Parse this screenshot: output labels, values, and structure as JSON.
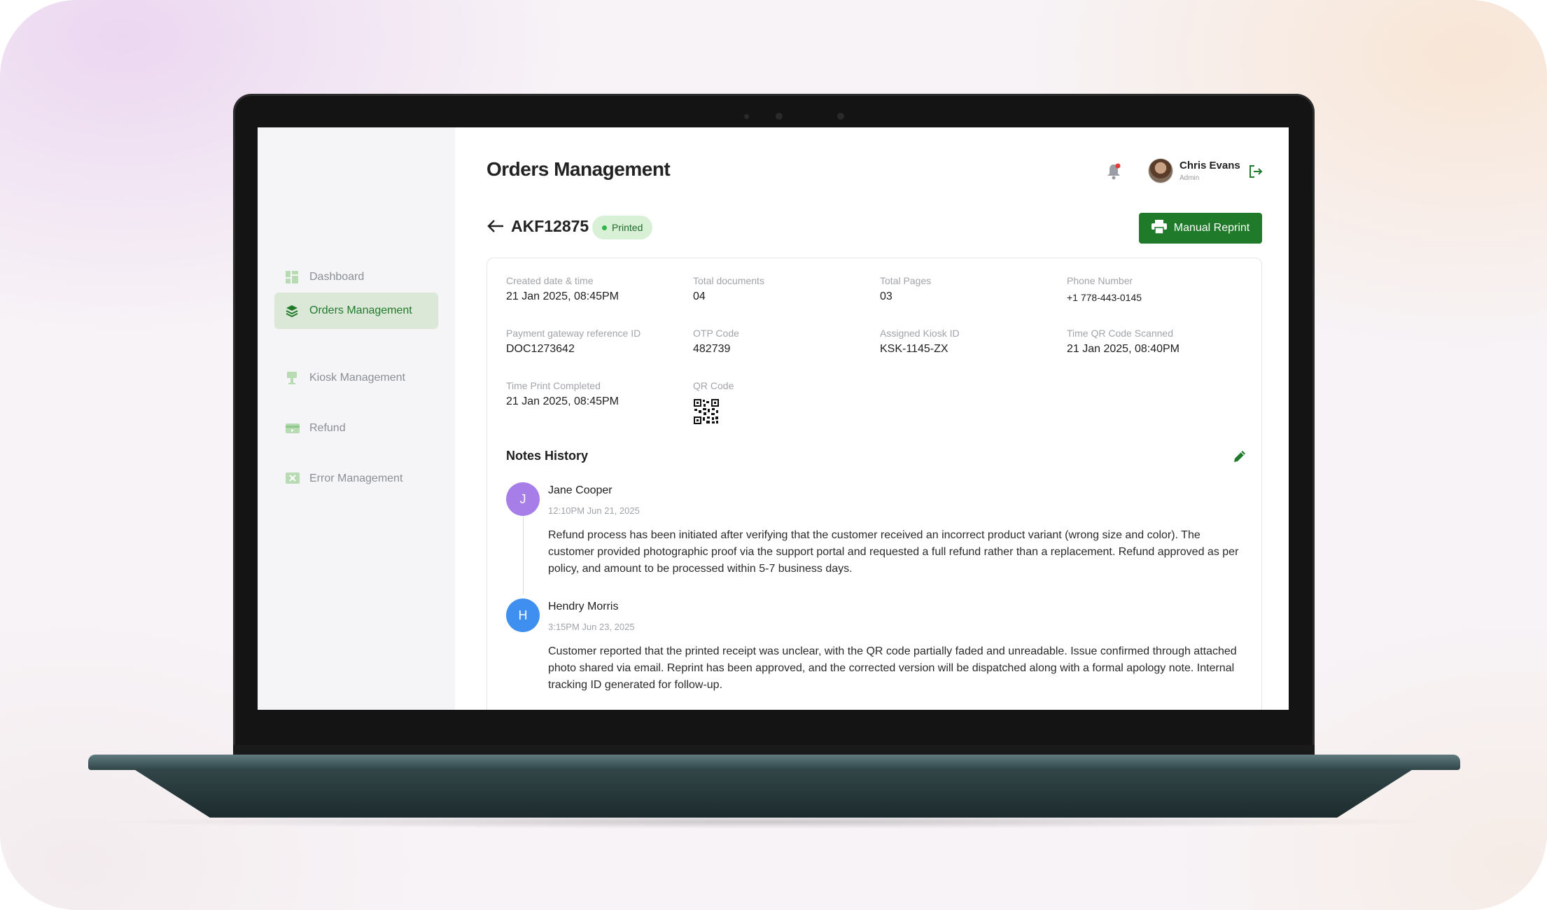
{
  "sidebar": {
    "items": [
      {
        "label": "Dashboard"
      },
      {
        "label": "Orders Management",
        "active": true
      },
      {
        "label": "Kiosk Management"
      },
      {
        "label": "Refund"
      },
      {
        "label": "Error Management"
      }
    ]
  },
  "header": {
    "title": "Orders Management",
    "user": {
      "name": "Chris Evans",
      "role": "Admin"
    }
  },
  "order": {
    "id": "AKF12875",
    "status": "Printed",
    "reprint_label": "Manual Reprint"
  },
  "details": {
    "created_label": "Created date & time",
    "created_value": "21 Jan 2025, 08:45PM",
    "docs_label": "Total documents",
    "docs_value": "04",
    "pages_label": "Total Pages",
    "pages_value": "03",
    "phone_label": "Phone Number",
    "phone_value": "+1 778-443-0145",
    "pg_label": "Payment gateway reference ID",
    "pg_value": "DOC1273642",
    "otp_label": "OTP Code",
    "otp_value": "482739",
    "kiosk_label": "Assigned Kiosk ID",
    "kiosk_value": "KSK-1145-ZX",
    "scan_label": "Time QR Code Scanned",
    "scan_value": "21 Jan 2025, 08:40PM",
    "print_label": "Time Print Completed",
    "print_value": "21 Jan 2025, 08:45PM",
    "qr_label": "QR Code"
  },
  "notes": {
    "title": "Notes History",
    "items": [
      {
        "initial": "J",
        "name": "Jane Cooper",
        "time": "12:10PM Jun 21, 2025",
        "text": "Refund process has been initiated after verifying that the customer received an incorrect product variant (wrong size and color). The customer provided photographic proof via the support portal and requested a full refund rather than a replacement. Refund approved as per policy, and amount to be processed within 5-7 business days.",
        "color": "#a77ee8"
      },
      {
        "initial": "H",
        "name": "Hendry Morris",
        "time": "3:15PM Jun 23, 2025",
        "text": "Customer reported that the printed receipt was unclear, with the QR code partially faded and unreadable. Issue confirmed through attached photo shared via email. Reprint has been approved, and the corrected version will be dispatched along with a formal apology note. Internal tracking ID generated for follow-up.",
        "color": "#3f8ff0"
      }
    ]
  },
  "colors": {
    "accent": "#1f7a2a",
    "badge_bg": "#d8f0d6",
    "nav_active_bg": "#dbe8d8"
  },
  "icons": [
    "dashboard-icon",
    "layers-icon",
    "kiosk-icon",
    "refund-icon",
    "error-icon",
    "bell-icon",
    "logout-icon",
    "back-arrow-icon",
    "printer-icon",
    "qr-code-icon",
    "edit-pencil-icon"
  ]
}
